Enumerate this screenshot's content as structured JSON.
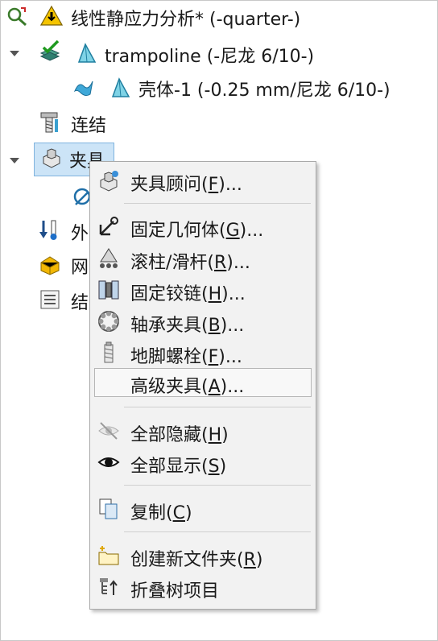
{
  "tree": {
    "study": "线性静应力分析* (-quarter-)",
    "part": "trampoline (-尼龙 6/10-)",
    "body": "壳体-1 (-0.25 mm/尼龙 6/10-)",
    "connections": "连结",
    "fixtures": "夹具",
    "external_loads": "外",
    "mesh": "网",
    "results": "结"
  },
  "menu": {
    "items": [
      {
        "prefix": "夹具顾问(",
        "key": "F",
        "suffix": ")..."
      },
      {
        "prefix": "固定几何体(",
        "key": "G",
        "suffix": ")..."
      },
      {
        "prefix": "滚柱/滑杆(",
        "key": "R",
        "suffix": ")..."
      },
      {
        "prefix": "固定铰链(",
        "key": "H",
        "suffix": ")..."
      },
      {
        "prefix": "轴承夹具(",
        "key": "B",
        "suffix": ")..."
      },
      {
        "prefix": "地脚螺栓(",
        "key": "F",
        "suffix": ")..."
      },
      {
        "prefix": "高级夹具(",
        "key": "A",
        "suffix": ")..."
      },
      {
        "prefix": "全部隐藏(",
        "key": "H",
        "suffix": ")"
      },
      {
        "prefix": "全部显示(",
        "key": "S",
        "suffix": ")"
      },
      {
        "prefix": "复制(",
        "key": "C",
        "suffix": ")"
      },
      {
        "prefix": "创建新文件夹(",
        "key": "R",
        "suffix": ")"
      },
      {
        "prefix": "折叠树项目",
        "key": "",
        "suffix": ""
      }
    ]
  }
}
